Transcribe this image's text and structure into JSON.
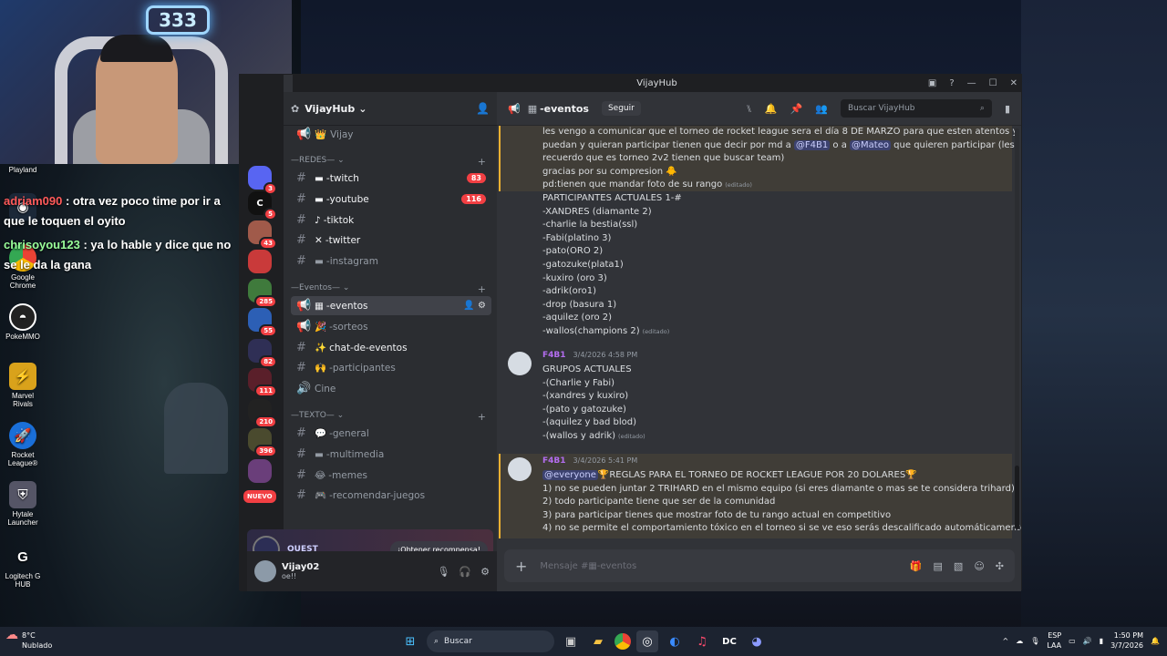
{
  "webcam": {
    "neon_text": "333"
  },
  "chat_overlay": [
    {
      "user": "adriam090",
      "text": ": otra vez poco time por ir a que le toquen el oyito"
    },
    {
      "user": "chrisoyou123",
      "text": ": ya lo hable y dice que no se le da la gana"
    }
  ],
  "desktop_icons": [
    {
      "label": "Playland",
      "icon": "playland-icon"
    },
    {
      "label": "Steam",
      "icon": "steam-icon"
    },
    {
      "label": "Google Chrome",
      "icon": "chrome-icon"
    },
    {
      "label": "PokeMMO",
      "icon": "pokemmo-icon"
    },
    {
      "label": "Marvel Rivals",
      "icon": "marvel-rivals-icon"
    },
    {
      "label": "Rocket League®",
      "icon": "rocket-league-icon"
    },
    {
      "label": "Hytale Launcher",
      "icon": "hytale-icon"
    },
    {
      "label": "Logitech G HUB",
      "icon": "logitech-icon"
    }
  ],
  "window": {
    "title": "VijayHub"
  },
  "guild_badges": [
    "3",
    "5",
    "43",
    "285",
    "55",
    "82",
    "111",
    "210",
    "396"
  ],
  "guild_new": "NUEVO",
  "server": {
    "name": "VijayHub",
    "chevron": "⌄"
  },
  "channels": {
    "top": {
      "name": "Vijay",
      "emoji": "👑"
    },
    "cat_redes": "—REDES— ⌄",
    "twitch": {
      "name": "-twitch",
      "emoji": "▬",
      "badge": "83"
    },
    "youtube": {
      "name": "-youtube",
      "emoji": "▬",
      "badge": "116"
    },
    "tiktok": {
      "name": "-tiktok",
      "emoji": "♪"
    },
    "twitter": {
      "name": "-twitter",
      "emoji": "✕"
    },
    "instagram": {
      "name": "-instagram",
      "emoji": "▬"
    },
    "cat_eventos": "—Eventos— ⌄",
    "eventos": {
      "name": "-eventos",
      "emoji": "▦"
    },
    "sorteos": {
      "name": "-sorteos",
      "emoji": "🎉"
    },
    "chat_eventos": {
      "name": "chat-de-eventos",
      "emoji": "✨"
    },
    "participantes": {
      "name": "-participantes",
      "emoji": "🙌"
    },
    "cine": {
      "name": "Cine",
      "emoji": ""
    },
    "cat_texto": "—TEXTO— ⌄",
    "general": {
      "name": "-general",
      "emoji": "💬"
    },
    "multimedia": {
      "name": "-multimedia",
      "emoji": "▬"
    },
    "memes": {
      "name": "-memes",
      "emoji": "😂"
    },
    "recomendar": {
      "name": "-recomendar-juegos",
      "emoji": "🎮"
    }
  },
  "promo": {
    "text": "QUEST",
    "button": "¡Obtener recompensa!"
  },
  "user": {
    "name": "Vijay02",
    "status": "oe!!"
  },
  "channel_header": {
    "name": "-eventos",
    "emoji": "▦",
    "follow": "Seguir",
    "search_placeholder": "Buscar VijayHub"
  },
  "messages": {
    "m1": [
      "les vengo a comunicar que el torneo de rocket league sera el día 8 DE MARZO para que esten atentos y los que",
      "recuerdo que es torneo 2v2 tienen que buscar team)",
      "gracias por su compresion 🐥"
    ],
    "m1_line2": {
      "before": "puedan y quieran participar tienen que decir  por md  a ",
      "mention1": "@F4B1",
      "mid": "  o a ",
      "mention2": "@Mateo",
      "after": " que quieren participar (les"
    },
    "m1_pd": "pd:tienen que mandar foto de su rango",
    "edited": "(editado)",
    "participants_title": "PARTICIPANTES ACTUALES 1-#",
    "participants": [
      "-XANDRES (diamante 2)",
      "-charlie la bestia(ssl)",
      "-Fabi(platino 3)",
      "-pato(ORO 2)",
      "-gatozuke(plata1)",
      "-kuxiro (oro 3)",
      "-adrik(oro1)",
      "-drop (basura 1)",
      "-aquilez (oro 2)"
    ],
    "participants_last": "-wallos(champions 2)",
    "m2": {
      "author": "F4B1",
      "time": "3/4/2026 4:58 PM"
    },
    "groups_title": "GRUPOS ACTUALES",
    "groups": [
      "-(Charlie y Fabi)",
      "-(xandres y kuxiro)",
      "-(pato y gatozuke)",
      "-(aquilez y bad blod)"
    ],
    "groups_last": "-(wallos y adrik)",
    "m3": {
      "author": "F4B1",
      "time": "3/4/2026 5:41 PM"
    },
    "m3_mention": "@everyone",
    "m3_title": "🏆REGLAS PARA EL TORNEO DE ROCKET LEAGUE POR 20 DOLARES🏆",
    "rules": [
      "1) no se pueden juntar 2 TRIHARD en el mismo equipo (si eres diamante o mas se te considera trihard)",
      "2) todo participante tiene que ser de la comunidad",
      "3) para participar tienes que mostrar foto de tu rango actual en competitivo",
      "4) no se permite el comportamiento tóxico en el torneo si se ve eso serás descalificado automáticamente"
    ]
  },
  "composer": {
    "placeholder": "Mensaje #▦-eventos"
  },
  "taskbar": {
    "temp": "8°C",
    "weather": "Nublado",
    "search": "Buscar",
    "lang1": "ESP",
    "lang2": "LAA",
    "time": "1:50 PM",
    "date": "3/7/2026"
  }
}
